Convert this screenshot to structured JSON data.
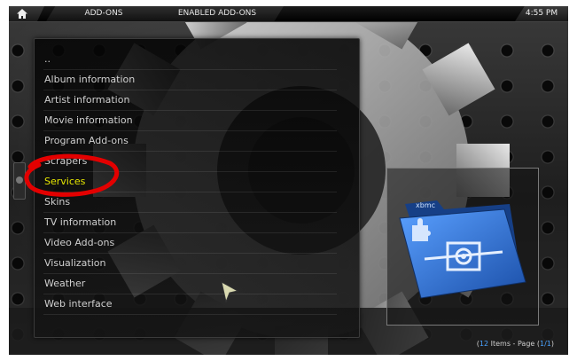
{
  "topbar": {
    "home_icon": "home-icon",
    "breadcrumbs": [
      "ADD-ONS",
      "ENABLED ADD-ONS"
    ],
    "time": "4:55 PM"
  },
  "list": {
    "items": [
      {
        "label": ".."
      },
      {
        "label": "Album information"
      },
      {
        "label": "Artist information"
      },
      {
        "label": "Movie information"
      },
      {
        "label": "Program Add-ons"
      },
      {
        "label": "Scrapers"
      },
      {
        "label": "Services",
        "selected": true
      },
      {
        "label": "Skins"
      },
      {
        "label": "TV information"
      },
      {
        "label": "Video Add-ons"
      },
      {
        "label": "Visualization"
      },
      {
        "label": "Weather"
      },
      {
        "label": "Web interface"
      }
    ]
  },
  "thumbnail": {
    "icon": "add-on-folder-icon",
    "tab_label": "xbmc"
  },
  "footer": {
    "count": "12",
    "items_text": " Items - Page (",
    "page": "1/1",
    "close_paren": ")"
  },
  "colors": {
    "selected_text": "#e6e600",
    "annotation_red": "#e30000",
    "folder_blue": "#2f6fd0"
  }
}
